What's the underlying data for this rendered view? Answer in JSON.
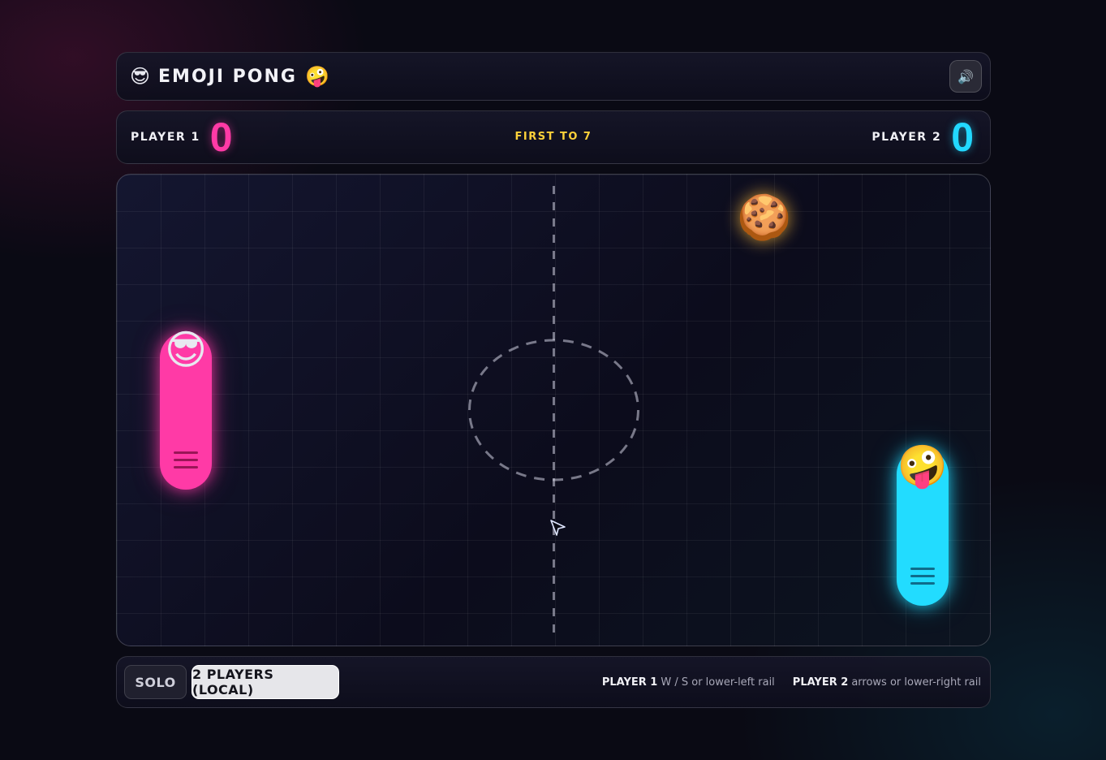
{
  "header": {
    "emoji_left": "😎",
    "title": "EMOJI PONG",
    "emoji_right": "🤪",
    "sound_icon": "🔊"
  },
  "scoreboard": {
    "player1_label": "PLAYER 1",
    "player1_score": "0",
    "goal_text": "FIRST TO 7",
    "player2_label": "PLAYER 2",
    "player2_score": "0"
  },
  "arena": {
    "left_paddle_emoji": "😎",
    "right_paddle_emoji": "🤪",
    "ball_emoji": "🍪",
    "left_paddle_color": "#ff3aa6",
    "right_paddle_color": "#22dcff"
  },
  "controls": {
    "modes": [
      "SOLO",
      "2 PLAYERS (LOCAL)"
    ],
    "active_mode": "2 PLAYERS (LOCAL)",
    "help": [
      {
        "player": "PLAYER 1",
        "keys": "W / S or lower-left rail"
      },
      {
        "player": "PLAYER 2",
        "keys": "arrows or lower-right rail"
      }
    ]
  }
}
